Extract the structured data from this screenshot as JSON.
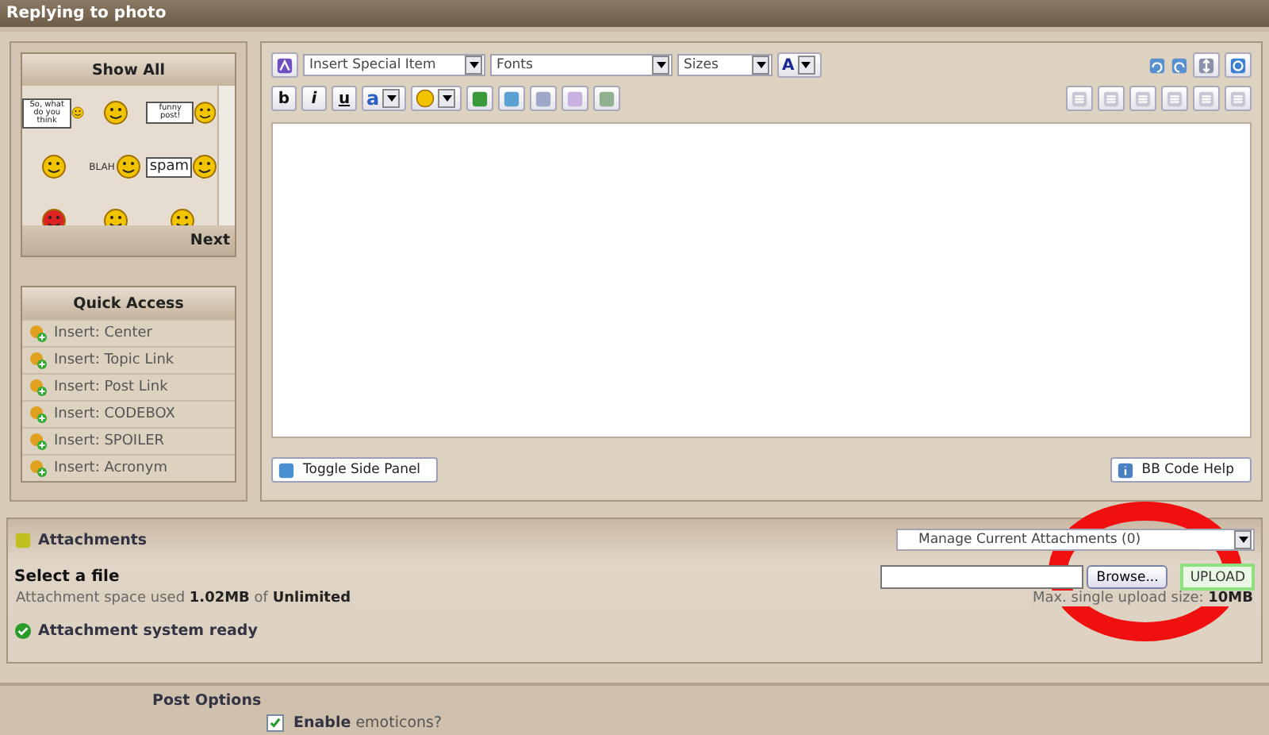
{
  "window": {
    "title": "Replying to photo"
  },
  "emoticons": {
    "title": "Show All",
    "next": "Next",
    "items": [
      {
        "kind": "sign",
        "text": "So, what do you think"
      },
      {
        "kind": "smiley"
      },
      {
        "kind": "sign",
        "text": "funny post!"
      },
      {
        "kind": "smiley"
      },
      {
        "kind": "blah",
        "text": "BLAH"
      },
      {
        "kind": "sign",
        "text": "spam"
      },
      {
        "kind": "angry"
      },
      {
        "kind": "smiley"
      },
      {
        "kind": "smiley"
      }
    ]
  },
  "quick_access": {
    "title": "Quick Access",
    "items": [
      "Insert: Center",
      "Insert: Topic Link",
      "Insert: Post Link",
      "Insert: CODEBOX",
      "Insert: SPOILER",
      "Insert: Acronym"
    ]
  },
  "toolbar": {
    "selects": [
      "Insert Special Item",
      "Fonts",
      "Sizes"
    ],
    "font_color": "A",
    "format_buttons": [
      "b",
      "i",
      "u"
    ],
    "text_color": "a"
  },
  "editor": {
    "toggle_button": "Toggle Side Panel",
    "help_button": "BB Code Help"
  },
  "attachments": {
    "title": "Attachments",
    "manage_select": "Manage Current Attachments (0)",
    "select_label": "Select a file",
    "space_used": "Attachment space used **1.02MB** of **Unlimited**",
    "browse_button": "Browse...",
    "upload_button": "UPLOAD",
    "max_size": "Max. single upload size: **10MB**",
    "status": "Attachment system ready"
  },
  "post_options": {
    "title": "Post Options",
    "options": [
      {
        "label": "**Enable** emoticons?",
        "checked": true
      }
    ]
  }
}
